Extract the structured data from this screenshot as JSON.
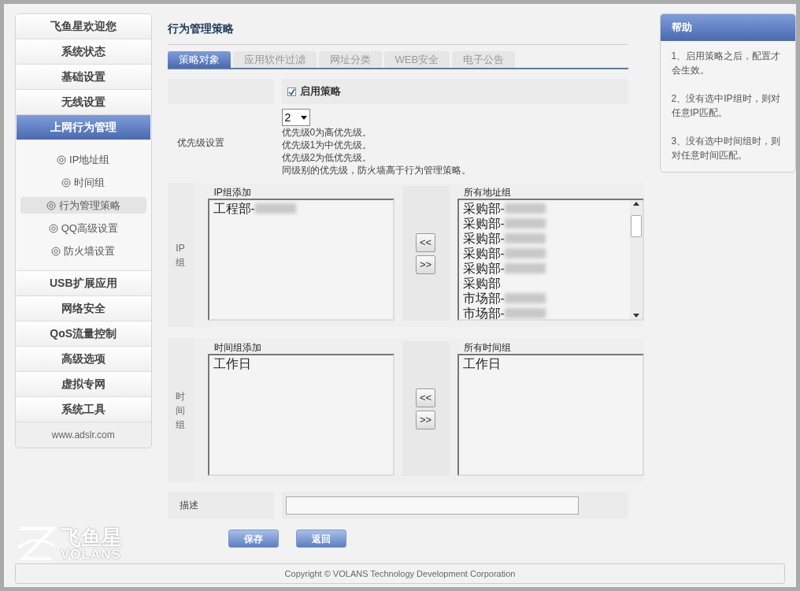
{
  "sidebar": {
    "items": [
      {
        "label": "飞鱼星欢迎您",
        "selected": false
      },
      {
        "label": "系统状态",
        "selected": false
      },
      {
        "label": "基础设置",
        "selected": false
      },
      {
        "label": "无线设置",
        "selected": false
      },
      {
        "label": "上网行为管理",
        "selected": true,
        "children": [
          {
            "label": "IP地址组",
            "selected": false
          },
          {
            "label": "时间组",
            "selected": false
          },
          {
            "label": "行为管理策略",
            "selected": true
          },
          {
            "label": "QQ高级设置",
            "selected": false
          },
          {
            "label": "防火墙设置",
            "selected": false
          }
        ]
      },
      {
        "label": "USB扩展应用",
        "selected": false
      },
      {
        "label": "网络安全",
        "selected": false
      },
      {
        "label": "QoS流量控制",
        "selected": false
      },
      {
        "label": "高级选项",
        "selected": false
      },
      {
        "label": "虚拟专网",
        "selected": false
      },
      {
        "label": "系统工具",
        "selected": false
      }
    ],
    "footer": "www.adslr.com"
  },
  "logo": {
    "name": "飞鱼星",
    "subtitle": "VOLANS"
  },
  "page_title": "行为管理策略",
  "tabs": [
    {
      "label": "策略对象",
      "selected": true
    },
    {
      "label": "应用软件过滤",
      "selected": false
    },
    {
      "label": "网址分类",
      "selected": false
    },
    {
      "label": "WEB安全",
      "selected": false
    },
    {
      "label": "电子公告",
      "selected": false
    }
  ],
  "enable": {
    "label": "启用策略",
    "checked": true
  },
  "priority": {
    "label": "优先级设置",
    "value": "2",
    "notes": [
      "优先级0为高优先级。",
      "优先级1为中优先级。",
      "优先级2为低优先级。",
      "同级别的优先级，防火墙高于行为管理策略。"
    ]
  },
  "groups": [
    {
      "label": "IP组",
      "left_title": "IP组添加",
      "left_items": [
        {
          "text": "工程部-",
          "redacted": true
        }
      ],
      "right_title": "所有地址组",
      "right_items": [
        {
          "text": "采购部-",
          "redacted": true
        },
        {
          "text": "采购部-",
          "redacted": true
        },
        {
          "text": "采购部-",
          "redacted": true
        },
        {
          "text": "采购部-",
          "redacted": true
        },
        {
          "text": "采购部-",
          "redacted": true
        },
        {
          "text": "采购部",
          "redacted": false
        },
        {
          "text": "市场部-",
          "redacted": true
        },
        {
          "text": "市场部-",
          "redacted": true
        }
      ],
      "scrollable": true,
      "add_button": "<<",
      "remove_button": ">>"
    },
    {
      "label": "时间组",
      "left_title": "时间组添加",
      "left_items": [
        {
          "text": "工作日",
          "redacted": false
        }
      ],
      "right_title": "所有时间组",
      "right_items": [
        {
          "text": "工作日",
          "redacted": false
        }
      ],
      "scrollable": false,
      "add_button": "<<",
      "remove_button": ">>"
    }
  ],
  "description": {
    "label": "描述"
  },
  "buttons": [
    "保存",
    "返回"
  ],
  "copyright": "Copyright © VOLANS Technology Development Corporation",
  "help": {
    "title": "帮助",
    "items": [
      "1、启用策略之后，配置才会生效。",
      "2、没有选中IP组时，则对任意IP匹配。",
      "3、没有选中时间组时，则对任意时间匹配。"
    ]
  }
}
